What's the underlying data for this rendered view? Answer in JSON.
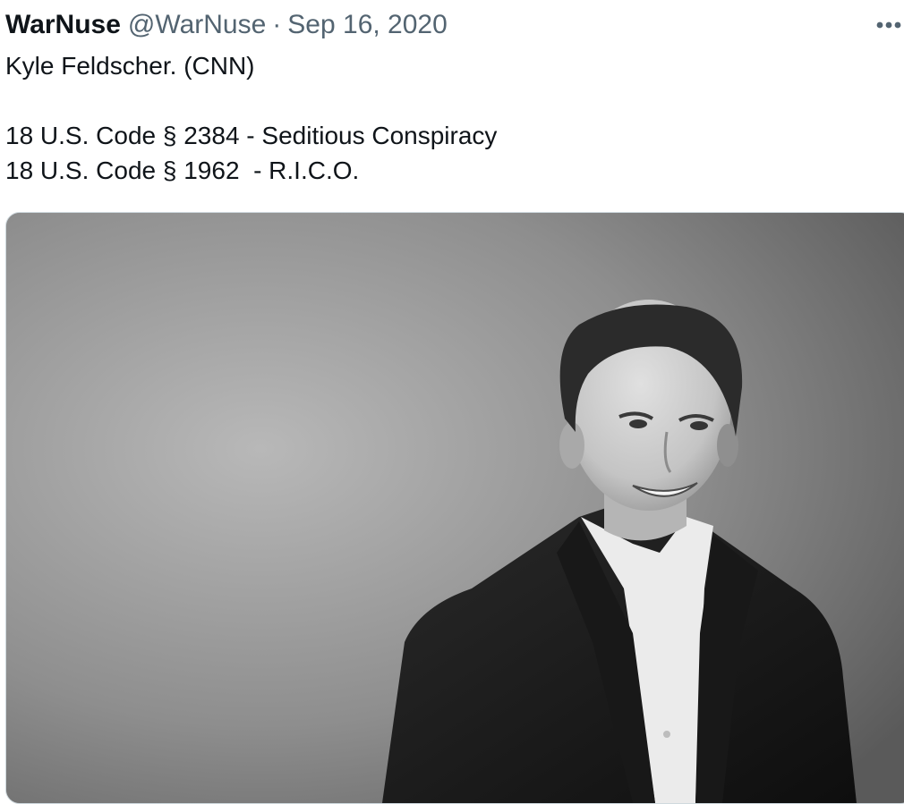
{
  "tweet": {
    "display_name": "WarNuse",
    "handle": "@WarNuse",
    "separator": "·",
    "date": "Sep 16, 2020",
    "more_icon": "more-horizontal-icon",
    "text_lines": [
      "Kyle Feldscher. (CNN)",
      "",
      "18 U.S. Code § 2384 - Seditious Conspiracy",
      "18 U.S. Code § 1962  - R.I.C.O."
    ],
    "media": {
      "kind": "black-and-white portrait photo",
      "subject": "smiling man in dark blazer and white open-collar shirt on gray studio backdrop"
    }
  },
  "colors": {
    "text_primary": "#0f1419",
    "text_secondary": "#536471",
    "media_border": "#cfd9de"
  }
}
